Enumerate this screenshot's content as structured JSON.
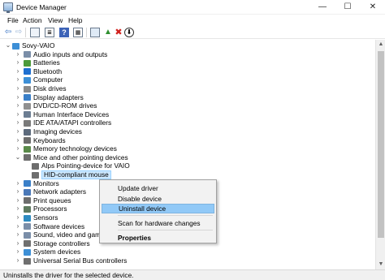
{
  "window": {
    "title": "Device Manager",
    "controls": {
      "minimize": "—",
      "maximize": "☐",
      "close": "✕"
    }
  },
  "menu": {
    "file": "File",
    "action": "Action",
    "view": "View",
    "help": "Help"
  },
  "toolbar": {
    "icons": [
      "back-icon",
      "forward-icon",
      "show-hide-console-tree-icon",
      "properties-icon",
      "help-icon",
      "view-grid-icon",
      "scan-hardware-icon",
      "update-driver-icon",
      "uninstall-icon",
      "disable-icon"
    ],
    "glyphs": {
      "back": "⇦",
      "forward": "⇨",
      "help": "?",
      "props": "≣",
      "grid": "▦",
      "update": "▲",
      "remove": "✖",
      "down": "⬇"
    }
  },
  "tree": {
    "root": "Sovy-VAIO",
    "categories": [
      {
        "label": "Audio inputs and outputs",
        "expanded": false,
        "icon": "speaker-icon",
        "color": "#7a8ea8"
      },
      {
        "label": "Batteries",
        "expanded": false,
        "icon": "battery-icon",
        "color": "#4c9a3a"
      },
      {
        "label": "Bluetooth",
        "expanded": false,
        "icon": "bluetooth-icon",
        "color": "#1e6fd0"
      },
      {
        "label": "Computer",
        "expanded": false,
        "icon": "computer-icon",
        "color": "#3d8fd6"
      },
      {
        "label": "Disk drives",
        "expanded": false,
        "icon": "disk-icon",
        "color": "#8a8a8a"
      },
      {
        "label": "Display adapters",
        "expanded": false,
        "icon": "display-icon",
        "color": "#3a7fc8"
      },
      {
        "label": "DVD/CD-ROM drives",
        "expanded": false,
        "icon": "dvd-icon",
        "color": "#909090"
      },
      {
        "label": "Human Interface Devices",
        "expanded": false,
        "icon": "hid-icon",
        "color": "#6b7d92"
      },
      {
        "label": "IDE ATA/ATAPI controllers",
        "expanded": false,
        "icon": "ide-icon",
        "color": "#7a7a7a"
      },
      {
        "label": "Imaging devices",
        "expanded": false,
        "icon": "camera-icon",
        "color": "#5c6a7c"
      },
      {
        "label": "Keyboards",
        "expanded": false,
        "icon": "keyboard-icon",
        "color": "#6d6d6d"
      },
      {
        "label": "Memory technology devices",
        "expanded": false,
        "icon": "memory-icon",
        "color": "#5a8a4a"
      },
      {
        "label": "Mice and other pointing devices",
        "expanded": true,
        "icon": "mouse-icon",
        "color": "#6e6e6e",
        "children": [
          "Alps Pointing-device for VAIO",
          "HID-compliant mouse"
        ]
      },
      {
        "label": "Monitors",
        "expanded": false,
        "icon": "monitor-icon",
        "color": "#3a7fc8"
      },
      {
        "label": "Network adapters",
        "expanded": false,
        "icon": "network-icon",
        "color": "#4a78b8"
      },
      {
        "label": "Print queues",
        "expanded": false,
        "icon": "printer-icon",
        "color": "#6d6d6d"
      },
      {
        "label": "Processors",
        "expanded": false,
        "icon": "cpu-icon",
        "color": "#5f7a5f"
      },
      {
        "label": "Sensors",
        "expanded": false,
        "icon": "sensor-icon",
        "color": "#2e8bc0"
      },
      {
        "label": "Software devices",
        "expanded": false,
        "icon": "software-icon",
        "color": "#7a8ea8"
      },
      {
        "label": "Sound, video and game co",
        "expanded": false,
        "icon": "sound-icon",
        "color": "#7a8ea8"
      },
      {
        "label": "Storage controllers",
        "expanded": false,
        "icon": "storage-icon",
        "color": "#6f6f6f"
      },
      {
        "label": "System devices",
        "expanded": false,
        "icon": "system-icon",
        "color": "#3d8fd6"
      },
      {
        "label": "Universal Serial Bus controllers",
        "expanded": false,
        "icon": "usb-icon",
        "color": "#6f6f6f"
      }
    ]
  },
  "context_menu": {
    "items": [
      "Update driver",
      "Disable device",
      "Uninstall device",
      "Scan for hardware changes",
      "Properties"
    ],
    "highlighted": "Uninstall device"
  },
  "status": "Uninstalls the driver for the selected device."
}
